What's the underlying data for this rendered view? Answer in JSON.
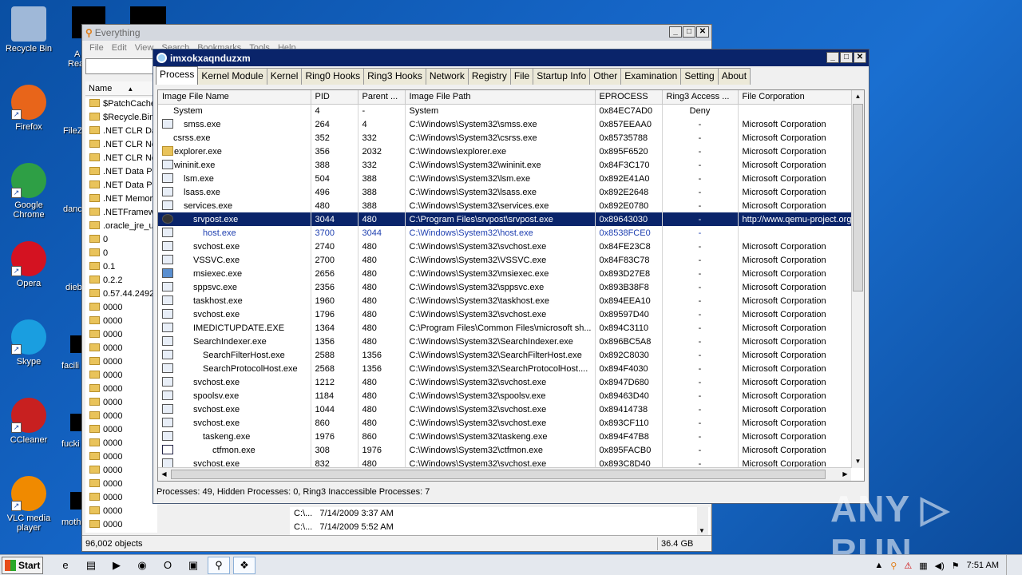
{
  "desktop": {
    "icons": [
      {
        "label": "Recycle Bin",
        "icon": "recycle-bin-icon",
        "color": "#9fb8d8"
      },
      {
        "label": "Firefox",
        "icon": "firefox-icon",
        "color": "#e8651a"
      },
      {
        "label": "Google Chrome",
        "icon": "chrome-icon",
        "color": "#2e9f45"
      },
      {
        "label": "Opera",
        "icon": "opera-icon",
        "color": "#d41221"
      },
      {
        "label": "Skype",
        "icon": "skype-icon",
        "color": "#1a9ee0"
      },
      {
        "label": "CCleaner",
        "icon": "ccleaner-icon",
        "color": "#c82020"
      },
      {
        "label": "VLC media player",
        "icon": "vlc-icon",
        "color": "#f08a00"
      }
    ],
    "stubs": [
      "A",
      "Rea",
      "FileZ",
      "danc",
      "dieb",
      "facili",
      "fucki",
      "moth"
    ]
  },
  "everything": {
    "title": "Everything",
    "menu": [
      "File",
      "Edit",
      "View",
      "Search",
      "Bookmarks",
      "Tools",
      "Help"
    ],
    "column_name": "Name",
    "rows": [
      "$PatchCache$",
      "$Recycle.Bin",
      ".NET CLR Data",
      ".NET CLR Networking",
      ".NET CLR Networking 4.0.0.0",
      ".NET Data Provider for Oracle",
      ".NET Data Provider for SqlServer",
      ".NET Memory Cache 4.0",
      ".NETFramework",
      ".oracle_jre_usage",
      "0",
      "0",
      "0.1",
      "0.2.2",
      "0.57.44.2492",
      "0000",
      "0000",
      "0000",
      "0000",
      "0000",
      "0000",
      "0000",
      "0000",
      "0000",
      "0000",
      "0000",
      "0000",
      "0000",
      "0000",
      "0000",
      "0000",
      "0000"
    ],
    "extra_rows": [
      "C:\\...   7/14/2009 3:37 AM",
      "C:\\...   7/14/2009 5:52 AM"
    ],
    "status_objects": "96,002 objects",
    "status_size": "36.4 GB"
  },
  "pchunter": {
    "title": "imxokxaqnduzxm",
    "tabs": [
      "Process",
      "Kernel Module",
      "Kernel",
      "Ring0 Hooks",
      "Ring3 Hooks",
      "Network",
      "Registry",
      "File",
      "Startup Info",
      "Other",
      "Examination",
      "Setting",
      "About"
    ],
    "columns": [
      "Image File Name",
      "PID",
      "Parent ...",
      "Image File Path",
      "EPROCESS",
      "Ring3 Access ...",
      "File Corporation"
    ],
    "rows": [
      {
        "icon": "none",
        "indent": 0,
        "name": "System",
        "pid": "4",
        "ppid": "-",
        "path": "System",
        "eprocess": "0x84EC7AD0",
        "access": "Deny",
        "corp": ""
      },
      {
        "icon": "exe",
        "indent": 1,
        "name": "smss.exe",
        "pid": "264",
        "ppid": "4",
        "path": "C:\\Windows\\System32\\smss.exe",
        "eprocess": "0x857EEAA0",
        "access": "-",
        "corp": "Microsoft Corporation"
      },
      {
        "icon": "none",
        "indent": 0,
        "name": "csrss.exe",
        "pid": "352",
        "ppid": "332",
        "path": "C:\\Windows\\System32\\csrss.exe",
        "eprocess": "0x85735788",
        "access": "-",
        "corp": "Microsoft Corporation"
      },
      {
        "icon": "folder",
        "indent": 0,
        "name": "explorer.exe",
        "pid": "356",
        "ppid": "2032",
        "path": "C:\\Windows\\explorer.exe",
        "eprocess": "0x895F6520",
        "access": "-",
        "corp": "Microsoft Corporation"
      },
      {
        "icon": "exe",
        "indent": 0,
        "name": "wininit.exe",
        "pid": "388",
        "ppid": "332",
        "path": "C:\\Windows\\System32\\wininit.exe",
        "eprocess": "0x84F3C170",
        "access": "-",
        "corp": "Microsoft Corporation"
      },
      {
        "icon": "exe",
        "indent": 1,
        "name": "lsm.exe",
        "pid": "504",
        "ppid": "388",
        "path": "C:\\Windows\\System32\\lsm.exe",
        "eprocess": "0x892E41A0",
        "access": "-",
        "corp": "Microsoft Corporation"
      },
      {
        "icon": "exe",
        "indent": 1,
        "name": "lsass.exe",
        "pid": "496",
        "ppid": "388",
        "path": "C:\\Windows\\System32\\lsass.exe",
        "eprocess": "0x892E2648",
        "access": "-",
        "corp": "Microsoft Corporation"
      },
      {
        "icon": "exe",
        "indent": 1,
        "name": "services.exe",
        "pid": "480",
        "ppid": "388",
        "path": "C:\\Windows\\System32\\services.exe",
        "eprocess": "0x892E0780",
        "access": "-",
        "corp": "Microsoft Corporation"
      },
      {
        "icon": "sphere",
        "indent": 2,
        "name": "srvpost.exe",
        "pid": "3044",
        "ppid": "480",
        "path": "C:\\Program Files\\srvpost\\srvpost.exe",
        "eprocess": "0x89643030",
        "access": "-",
        "corp": "http://www.qemu-project.org",
        "selected": true
      },
      {
        "icon": "exe",
        "indent": 3,
        "name": "host.exe",
        "pid": "3700",
        "ppid": "3044",
        "path": "C:\\Windows\\System32\\host.exe",
        "eprocess": "0x8538FCE0",
        "access": "-",
        "corp": "",
        "blue": true
      },
      {
        "icon": "exe",
        "indent": 2,
        "name": "svchost.exe",
        "pid": "2740",
        "ppid": "480",
        "path": "C:\\Windows\\System32\\svchost.exe",
        "eprocess": "0x84FE23C8",
        "access": "-",
        "corp": "Microsoft Corporation"
      },
      {
        "icon": "exe",
        "indent": 2,
        "name": "VSSVC.exe",
        "pid": "2700",
        "ppid": "480",
        "path": "C:\\Windows\\System32\\VSSVC.exe",
        "eprocess": "0x84F83C78",
        "access": "-",
        "corp": "Microsoft Corporation"
      },
      {
        "icon": "gear",
        "indent": 2,
        "name": "msiexec.exe",
        "pid": "2656",
        "ppid": "480",
        "path": "C:\\Windows\\System32\\msiexec.exe",
        "eprocess": "0x893D27E8",
        "access": "-",
        "corp": "Microsoft Corporation"
      },
      {
        "icon": "exe",
        "indent": 2,
        "name": "sppsvc.exe",
        "pid": "2356",
        "ppid": "480",
        "path": "C:\\Windows\\System32\\sppsvc.exe",
        "eprocess": "0x893B38F8",
        "access": "-",
        "corp": "Microsoft Corporation"
      },
      {
        "icon": "exe",
        "indent": 2,
        "name": "taskhost.exe",
        "pid": "1960",
        "ppid": "480",
        "path": "C:\\Windows\\System32\\taskhost.exe",
        "eprocess": "0x894EEA10",
        "access": "-",
        "corp": "Microsoft Corporation"
      },
      {
        "icon": "exe",
        "indent": 2,
        "name": "svchost.exe",
        "pid": "1796",
        "ppid": "480",
        "path": "C:\\Windows\\System32\\svchost.exe",
        "eprocess": "0x89597D40",
        "access": "-",
        "corp": "Microsoft Corporation"
      },
      {
        "icon": "exe",
        "indent": 2,
        "name": "IMEDICTUPDATE.EXE",
        "pid": "1364",
        "ppid": "480",
        "path": "C:\\Program Files\\Common Files\\microsoft sh...",
        "eprocess": "0x894C3110",
        "access": "-",
        "corp": "Microsoft Corporation"
      },
      {
        "icon": "exe",
        "indent": 2,
        "name": "SearchIndexer.exe",
        "pid": "1356",
        "ppid": "480",
        "path": "C:\\Windows\\System32\\SearchIndexer.exe",
        "eprocess": "0x896BC5A8",
        "access": "-",
        "corp": "Microsoft Corporation"
      },
      {
        "icon": "exe",
        "indent": 3,
        "name": "SearchFilterHost.exe",
        "pid": "2588",
        "ppid": "1356",
        "path": "C:\\Windows\\System32\\SearchFilterHost.exe",
        "eprocess": "0x892C8030",
        "access": "-",
        "corp": "Microsoft Corporation"
      },
      {
        "icon": "exe",
        "indent": 3,
        "name": "SearchProtocolHost.exe",
        "pid": "2568",
        "ppid": "1356",
        "path": "C:\\Windows\\System32\\SearchProtocolHost....",
        "eprocess": "0x894F4030",
        "access": "-",
        "corp": "Microsoft Corporation"
      },
      {
        "icon": "exe",
        "indent": 2,
        "name": "svchost.exe",
        "pid": "1212",
        "ppid": "480",
        "path": "C:\\Windows\\System32\\svchost.exe",
        "eprocess": "0x8947D680",
        "access": "-",
        "corp": "Microsoft Corporation"
      },
      {
        "icon": "exe",
        "indent": 2,
        "name": "spoolsv.exe",
        "pid": "1184",
        "ppid": "480",
        "path": "C:\\Windows\\System32\\spoolsv.exe",
        "eprocess": "0x89463D40",
        "access": "-",
        "corp": "Microsoft Corporation"
      },
      {
        "icon": "exe",
        "indent": 2,
        "name": "svchost.exe",
        "pid": "1044",
        "ppid": "480",
        "path": "C:\\Windows\\System32\\svchost.exe",
        "eprocess": "0x89414738",
        "access": "-",
        "corp": "Microsoft Corporation"
      },
      {
        "icon": "exe",
        "indent": 2,
        "name": "svchost.exe",
        "pid": "860",
        "ppid": "480",
        "path": "C:\\Windows\\System32\\svchost.exe",
        "eprocess": "0x893CF110",
        "access": "-",
        "corp": "Microsoft Corporation"
      },
      {
        "icon": "exe",
        "indent": 3,
        "name": "taskeng.exe",
        "pid": "1976",
        "ppid": "860",
        "path": "C:\\Windows\\System32\\taskeng.exe",
        "eprocess": "0x894F47B8",
        "access": "-",
        "corp": "Microsoft Corporation"
      },
      {
        "icon": "pen",
        "indent": 4,
        "name": "ctfmon.exe",
        "pid": "308",
        "ppid": "1976",
        "path": "C:\\Windows\\System32\\ctfmon.exe",
        "eprocess": "0x895FACB0",
        "access": "-",
        "corp": "Microsoft Corporation"
      },
      {
        "icon": "exe",
        "indent": 2,
        "name": "svchost.exe",
        "pid": "832",
        "ppid": "480",
        "path": "C:\\Windows\\System32\\svchost.exe",
        "eprocess": "0x893C8D40",
        "access": "-",
        "corp": "Microsoft Corporation"
      }
    ],
    "status": "Processes: 49, Hidden Processes: 0, Ring3 Inaccessible Processes: 7"
  },
  "taskbar": {
    "start_label": "Start",
    "items": [
      {
        "icon": "ie-icon",
        "glyph": "e"
      },
      {
        "icon": "explorer-icon",
        "glyph": "▤"
      },
      {
        "icon": "media-player-icon",
        "glyph": "▶"
      },
      {
        "icon": "chrome-icon",
        "glyph": "◉"
      },
      {
        "icon": "opera-icon",
        "glyph": "O"
      },
      {
        "icon": "window-icon",
        "glyph": "▣"
      },
      {
        "icon": "everything-icon",
        "glyph": "⚲"
      },
      {
        "icon": "pchunter-icon",
        "glyph": "❖"
      }
    ],
    "clock": "7:51 AM"
  },
  "watermark": "ANY ▷ RUN"
}
